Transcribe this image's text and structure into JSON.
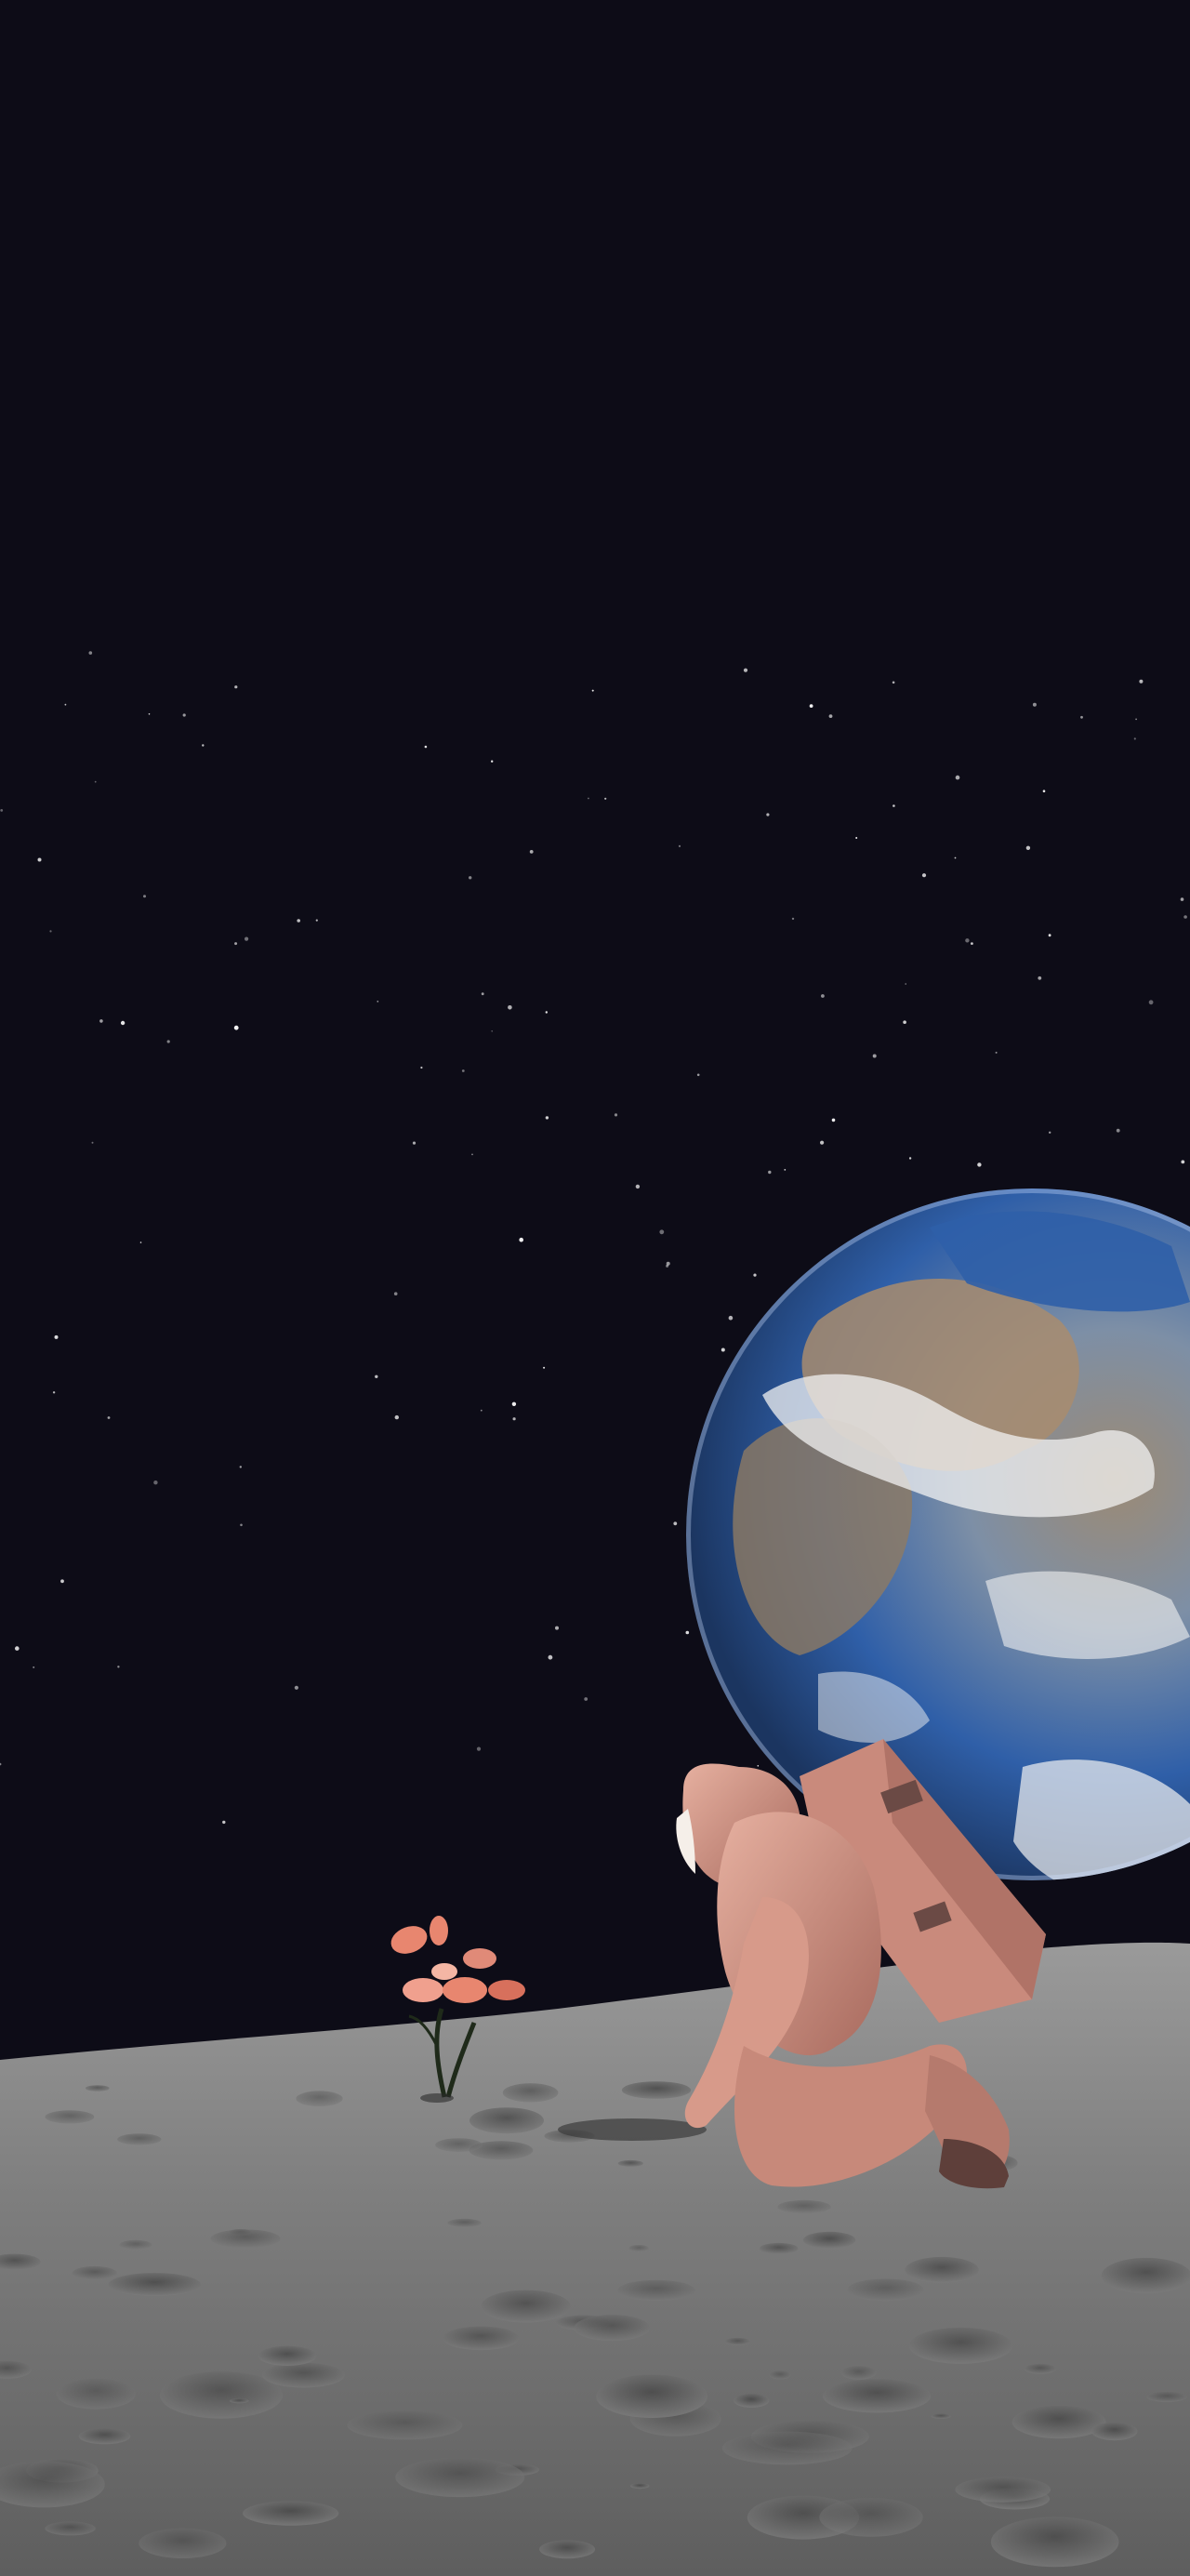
{
  "scene": {
    "sky_color": "#0d0c17",
    "ground_color": "#8c8c8c",
    "planet": {
      "name": "earth-icon",
      "ocean": "#2f5fa8",
      "land": "#a88c6e",
      "cloud": "#f2f2f2"
    },
    "astronaut": {
      "name": "astronaut-icon",
      "suit": "#d79a8a",
      "shadow": "#5e3f3a"
    },
    "flower": {
      "name": "flower-icon",
      "petal": "#e8866f",
      "stem": "#1f2a1a"
    }
  }
}
